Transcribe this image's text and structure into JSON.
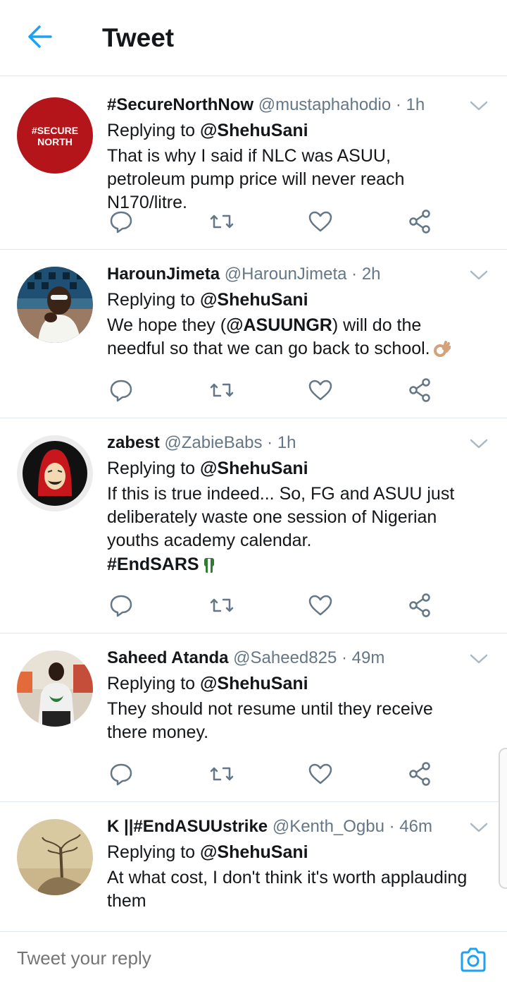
{
  "header": {
    "title": "Tweet",
    "back_icon": "arrow-left-icon",
    "accent_color": "#1da1f2"
  },
  "tweets": [
    {
      "display_name": "#SecureNorthNow",
      "handle": "@mustaphahodio",
      "time": "· 1h",
      "replying_prefix": "Replying to",
      "replying_to": "@ShehuSani",
      "text": "That is why I said if NLC was ASUU, petroleum pump price will never reach N170/litre.",
      "avatar_text": [
        "#SECURE",
        "NORTH"
      ],
      "avatar_color": "#b3151b"
    },
    {
      "display_name": "HarounJimeta",
      "handle": "@HarounJimeta",
      "time": "· 2h",
      "replying_prefix": "Replying to",
      "replying_to": "@ShehuSani",
      "text_before": "We hope they (",
      "mention": "@ASUUNGR",
      "text_after": ") will do the needful so that we can go back to school.",
      "emoji": "ok-hand-emoji"
    },
    {
      "display_name": "zabest",
      "handle": "@ZabieBabs",
      "time": "· 1h",
      "replying_prefix": "Replying to",
      "replying_to": "@ShehuSani",
      "text": "If this is true indeed... So, FG and ASUU just deliberately waste one session of Nigerian youths academy calendar.",
      "hashtag": "#EndSARS",
      "emoji": "raised-fist-emoji"
    },
    {
      "display_name": "Saheed Atanda",
      "handle": "@Saheed825",
      "time": "· 49m",
      "replying_prefix": "Replying to",
      "replying_to": "@ShehuSani",
      "text": "They should not resume until they receive there money."
    },
    {
      "display_name": "K ||#EndASUUstrike",
      "handle": "@Kenth_Ogbu",
      "time": "· 46m",
      "replying_prefix": "Replying to",
      "replying_to": "@ShehuSani",
      "text": "At what cost, I don't think it's worth applauding them"
    }
  ],
  "action_icons": [
    "reply-icon",
    "retweet-icon",
    "like-icon",
    "share-icon"
  ],
  "reply_bar": {
    "placeholder": "Tweet your reply",
    "camera_icon": "camera-icon"
  },
  "colors": {
    "text_primary": "#14171a",
    "text_secondary": "#657786",
    "divider": "#e1e8ed",
    "accent": "#1da1f2"
  }
}
